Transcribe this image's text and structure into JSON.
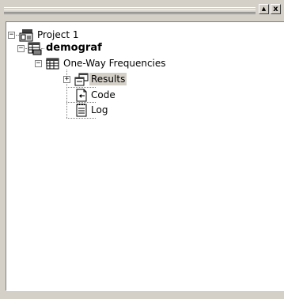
{
  "toolbar": {
    "scroll_up_glyph": "▲",
    "close_glyph": "x"
  },
  "tree": {
    "project": {
      "label": "Project 1",
      "icon": "project-icon",
      "expanded": true
    },
    "dataset": {
      "label": "demograf",
      "icon": "dataset-icon",
      "expanded": true
    },
    "task": {
      "label": "One-Way Frequencies",
      "icon": "task-icon",
      "expanded": true
    },
    "results": {
      "label": "Results",
      "icon": "results-icon",
      "expanded": false,
      "selected": true
    },
    "code": {
      "label": "Code",
      "icon": "code-icon"
    },
    "log": {
      "label": "Log",
      "icon": "log-icon"
    }
  },
  "colors": {
    "chrome": "#d4d0c8",
    "tree_bg": "#ffffff",
    "selection": "#d4d0c8"
  }
}
